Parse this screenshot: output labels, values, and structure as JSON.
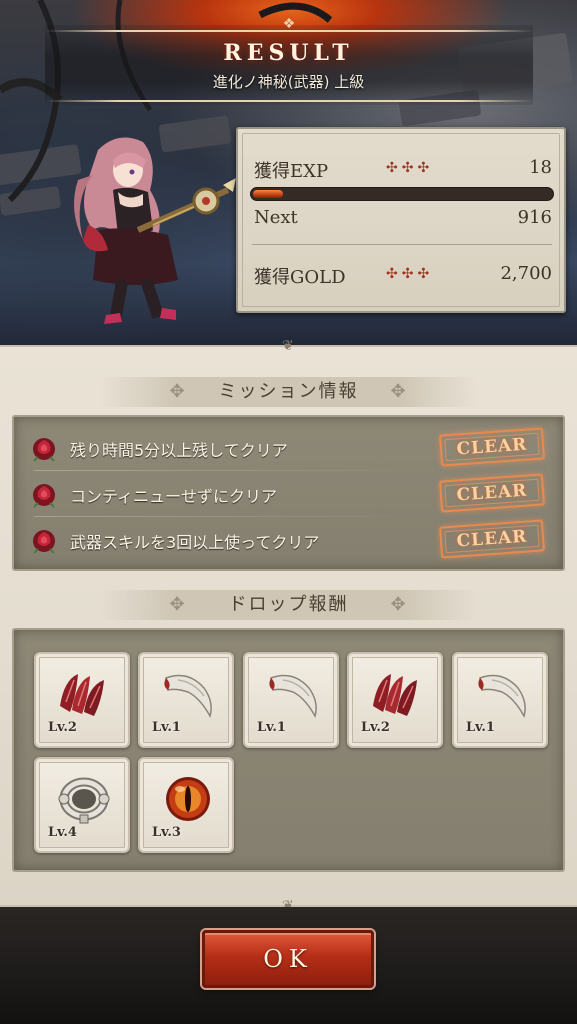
{
  "header": {
    "title": "RESULT",
    "subtitle": "進化ノ神秘(武器) 上級"
  },
  "stats": {
    "exp_label": "獲得EXP",
    "exp_value": "18",
    "exp_progress_fraction": 0.1,
    "next_label": "Next",
    "next_value": "916",
    "gold_label": "獲得GOLD",
    "gold_value": "2,700",
    "crosses": "✣✣✣"
  },
  "missions": {
    "header": "ミッション情報",
    "items": [
      {
        "text": "残り時間5分以上残してクリア",
        "status": "CLEAR"
      },
      {
        "text": "コンティニューせずにクリア",
        "status": "CLEAR"
      },
      {
        "text": "武器スキルを3回以上使ってクリア",
        "status": "CLEAR"
      }
    ]
  },
  "drops": {
    "header": "ドロップ報酬",
    "items": [
      {
        "icon": "red-scale-icon",
        "level": "Lv.2"
      },
      {
        "icon": "fang-icon",
        "level": "Lv.1"
      },
      {
        "icon": "fang-icon",
        "level": "Lv.1"
      },
      {
        "icon": "red-scale-icon",
        "level": "Lv.2"
      },
      {
        "icon": "fang-icon",
        "level": "Lv.1"
      },
      {
        "icon": "silver-ring-icon",
        "level": "Lv.4"
      },
      {
        "icon": "eye-orb-icon",
        "level": "Lv.3"
      }
    ]
  },
  "footer": {
    "ok_label": "OK"
  },
  "colors": {
    "accent_red": "#b52e17",
    "clear_orange": "#e88a50",
    "parchment": "#e9e2d5"
  }
}
